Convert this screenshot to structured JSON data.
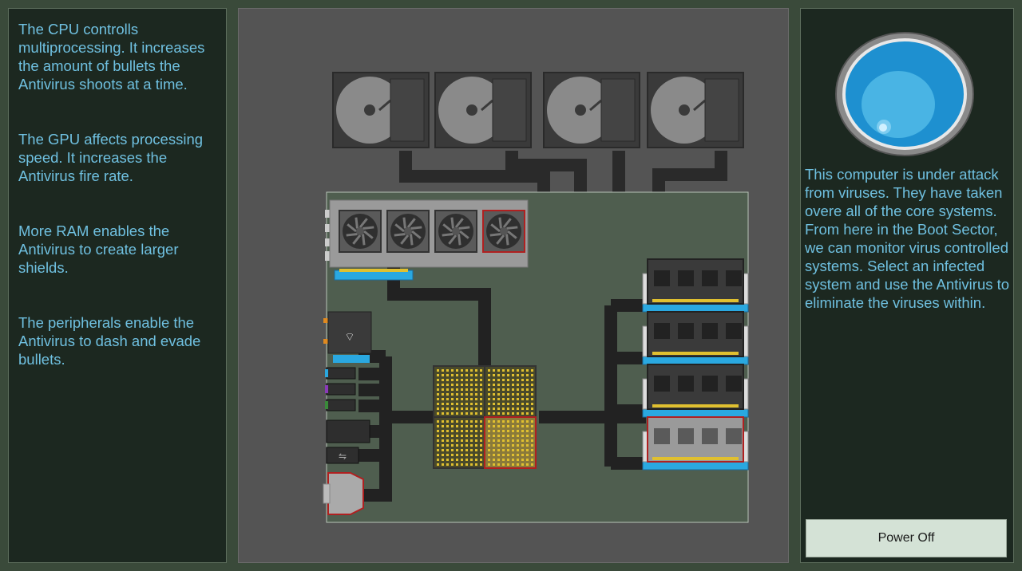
{
  "left_panel": {
    "cpu_text": "The CPU controlls multiprocessing. It increases the amount of bullets the Antivirus shoots at a time.",
    "gpu_text": "The GPU affects processing speed. It increases the Antivirus fire rate.",
    "ram_text": "More RAM enables the Antivirus to create larger shields.",
    "peripherals_text": "The peripherals enable the Antivirus to dash and evade bullets."
  },
  "right_panel": {
    "intro_text": "This computer is under attack from viruses. They have taken overe all of the core systems. From here in the Boot Sector, we can monitor virus controlled systems. Select an infected system and use the Antivirus to eliminate the viruses within.",
    "power_button_label": "Power Off"
  },
  "board": {
    "hard_drives": 4,
    "gpu_fans": 4,
    "ram_sticks": 4,
    "cpu_cores": 4,
    "infected": {
      "hard_drives": [],
      "gpu_fans": [
        4
      ],
      "ram_sticks": [
        4
      ],
      "cpu_cores": [
        4
      ],
      "peripherals": [
        "serial-port"
      ]
    }
  },
  "colors": {
    "panel_bg": "#1c2820",
    "text": "#6fc0e0",
    "board": "#4f5e4f",
    "accent_slot": "#2aa8e0",
    "infected_outline": "#b02020",
    "orb": "#1e90d0"
  }
}
